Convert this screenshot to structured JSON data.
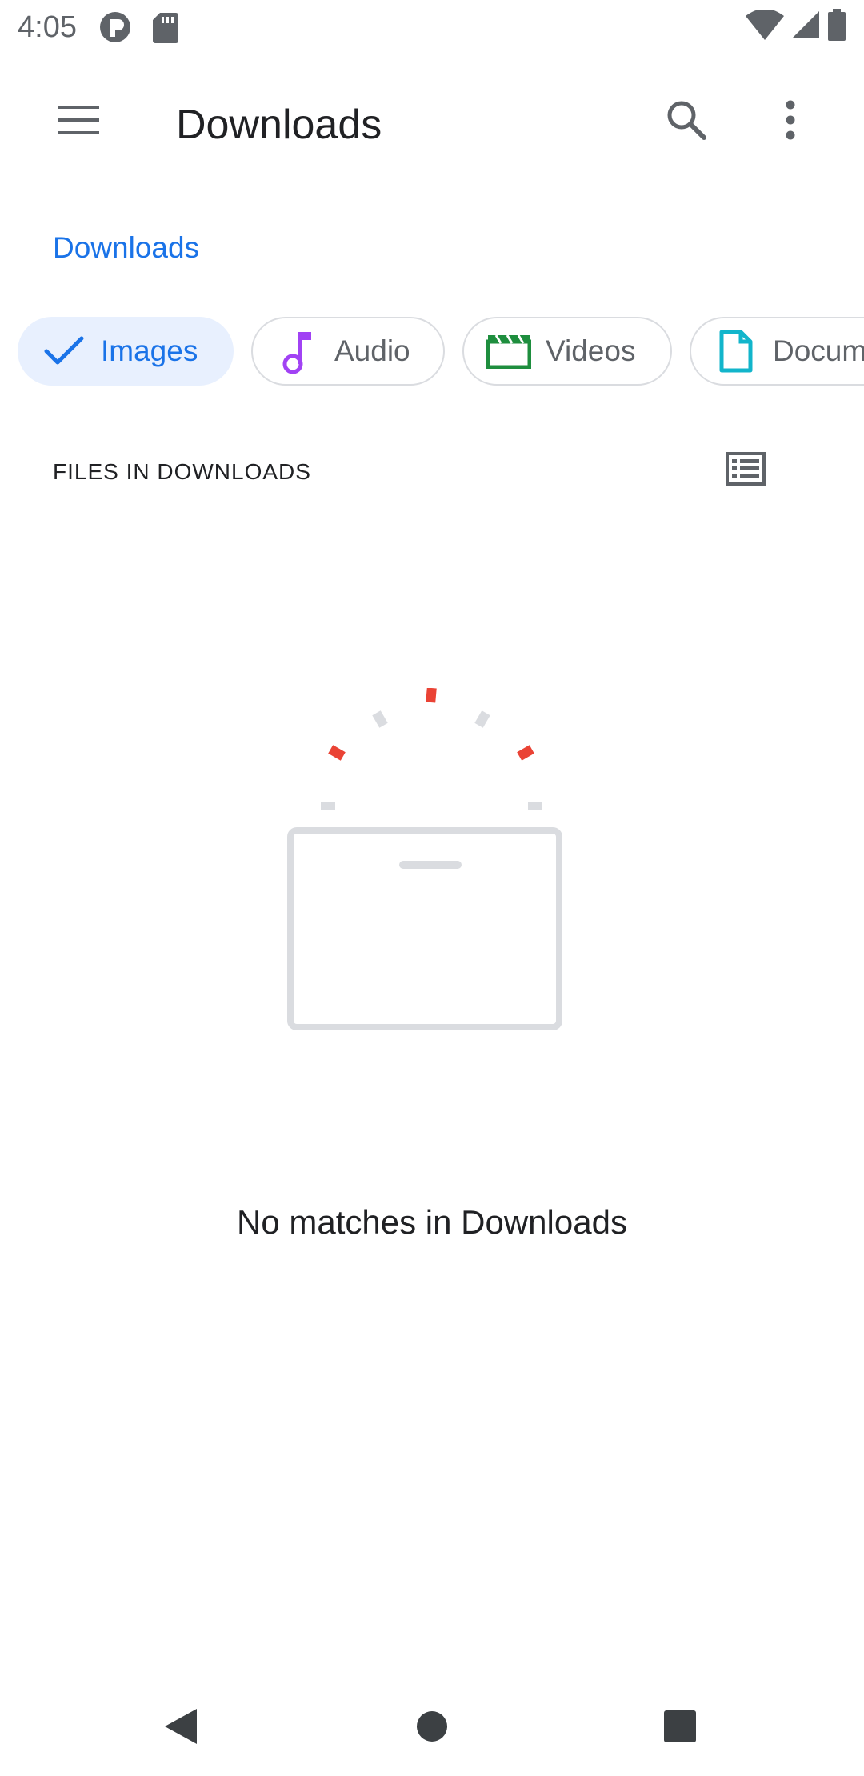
{
  "status_bar": {
    "time": "4:05",
    "left_icons": [
      "app-notification-icon",
      "sd-card-icon"
    ],
    "right_icons": [
      "wifi-icon",
      "cell-signal-icon",
      "battery-icon"
    ]
  },
  "app_bar": {
    "menu_icon": "menu-icon",
    "title": "Downloads",
    "search_icon": "search-icon",
    "more_icon": "more-vert-icon"
  },
  "breadcrumb": {
    "label": "Downloads"
  },
  "chips": [
    {
      "label": "Images",
      "icon": "check-icon",
      "selected": true,
      "color": "#1a73e8"
    },
    {
      "label": "Audio",
      "icon": "music-note-icon",
      "selected": false,
      "color": "#a142f4"
    },
    {
      "label": "Videos",
      "icon": "movie-icon",
      "selected": false,
      "color": "#1e8e3e"
    },
    {
      "label": "Docum",
      "icon": "document-icon",
      "selected": false,
      "color": "#12b5cb"
    }
  ],
  "section": {
    "label": "FILES IN DOWNLOADS",
    "view_toggle_icon": "list-view-icon"
  },
  "empty_state": {
    "message": "No matches in Downloads",
    "illustration": "empty-box-illustration-icon"
  },
  "nav_bar": {
    "back_icon": "back-icon",
    "home_icon": "home-icon",
    "recents_icon": "recents-icon"
  },
  "colors": {
    "accent": "#1a73e8",
    "selected_chip_bg": "#e8f0fe",
    "chip_border": "#dadce0",
    "illustration_gray": "#dadce0",
    "illustration_red": "#ea4335"
  }
}
